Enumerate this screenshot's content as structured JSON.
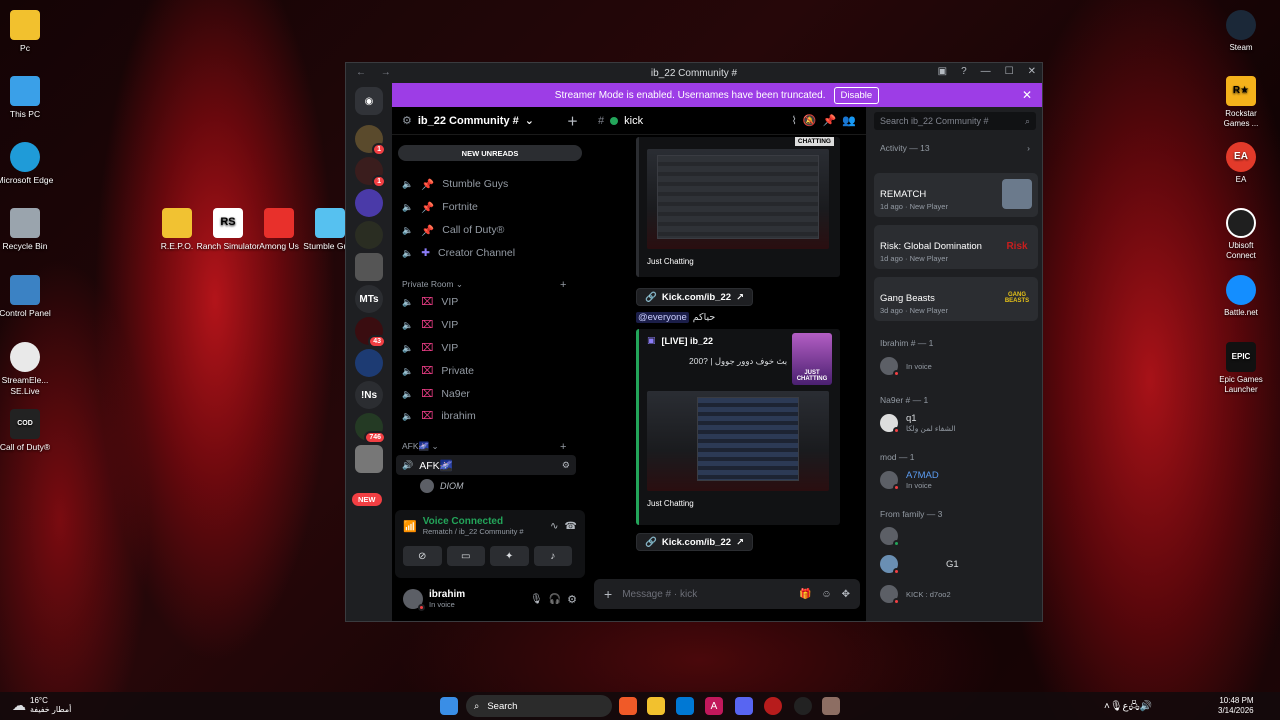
{
  "desktop_left": [
    {
      "label": "Pc",
      "icon": "folder-icon",
      "color": "#f2c12e"
    },
    {
      "label": "This PC",
      "icon": "monitor-icon",
      "color": "#3aa0e8"
    },
    {
      "label": "Microsoft Edge",
      "icon": "edge-icon",
      "color": "#1f9bd8"
    },
    {
      "label": "Recycle Bin",
      "icon": "recycle-bin-icon",
      "color": "#9aa4ad"
    },
    {
      "label": "Control Panel",
      "icon": "control-panel-icon",
      "color": "#3b82c4"
    },
    {
      "label": "StreamEle... SE.Live",
      "icon": "streamelements-icon",
      "color": "#e9e9e9"
    },
    {
      "label": "Call of Duty®",
      "icon": "call-of-duty-icon",
      "color": "#222"
    }
  ],
  "desktop_games": [
    {
      "label": "R.E.P.O.",
      "color": "#f1c232"
    },
    {
      "label": "Ranch Simulator",
      "color": "#ffffff"
    },
    {
      "label": "Among Us",
      "color": "#e8302b"
    },
    {
      "label": "Stumble Guys",
      "color": "#56c1f0"
    }
  ],
  "desktop_right": [
    {
      "label": "Steam",
      "color": "#1b2838"
    },
    {
      "label": "Rockstar Games ...",
      "color": "#f5b21b"
    },
    {
      "label": "EA",
      "color": "#e23a2a"
    },
    {
      "label": "Ubisoft Connect",
      "color": "#1f1f1f"
    },
    {
      "label": "Battle.net",
      "color": "#148eff"
    },
    {
      "label": "Epic Games Launcher",
      "color": "#111"
    }
  ],
  "window": {
    "title": "ib_22 Community #",
    "nav": "← →"
  },
  "banner": {
    "text": "Streamer Mode is enabled. Usernames have been truncated.",
    "button": "Disable"
  },
  "rail_badges": [
    "1",
    "1",
    "43",
    "746",
    "NEW"
  ],
  "rail_labels": [
    "MTs",
    "!Ns"
  ],
  "server": {
    "name": "ib_22 Community #",
    "new_unreads": "NEW UNREADS"
  },
  "channels_top": [
    "Stumble Guys",
    "Fortnite",
    "Call of Duty®",
    "Creator Channel"
  ],
  "private_category": "Private Room",
  "private_channels": [
    "VIP",
    "VIP",
    "VIP",
    "Private",
    "Na9er",
    "ibrahim"
  ],
  "afk_category": "AFK🌌",
  "afk_channel": "AFK🌌",
  "afk_user": "DIOM",
  "voice": {
    "status": "Voice Connected",
    "detail": "Rematch / ib_22 Community #"
  },
  "user": {
    "name": "ibrahim",
    "status": "In voice"
  },
  "chat": {
    "channel": "kick",
    "placeholder": "Message # · kick",
    "embed1_caption": "Just Chatting",
    "link": "Kick.com/ib_22",
    "mention": "@everyone",
    "mention_text": "حياكم",
    "embed2_title": "[LIVE] ib_22",
    "embed2_desc": "200? | بث خوف دوور جوول",
    "embed2_caption": "Just Chatting",
    "thumb_label": "JUST CHATTING",
    "chatting_tag": "CHATTING"
  },
  "members": {
    "search": "Search ib_22 Community #",
    "activity": "Activity — 13",
    "activities": [
      {
        "title": "REMATCH",
        "sub": "1d ago",
        "tag": "New Player",
        "art": "#6b7a8c"
      },
      {
        "title": "Risk: Global Domination",
        "sub": "1d ago",
        "tag": "New Player",
        "art": "#c81e1e",
        "art_text": "Risk"
      },
      {
        "title": "Gang Beasts",
        "sub": "3d ago",
        "tag": "New Player",
        "art": "#e7c318",
        "art_text": "GANG BEASTS"
      }
    ],
    "sections": [
      {
        "header": "Ibrahim # — 1",
        "members": [
          {
            "name": "",
            "sub": "In voice"
          }
        ]
      },
      {
        "header": "Na9er # — 1",
        "members": [
          {
            "name": "q1",
            "sub": "الشفاء لمن ولكا"
          }
        ]
      },
      {
        "header": "mod — 1",
        "members": [
          {
            "name": "A7MAD",
            "sub": "In voice"
          }
        ]
      },
      {
        "header": "From family — 3",
        "members": [
          {
            "name": "",
            "sub": ""
          },
          {
            "name": "G1",
            "sub": ""
          },
          {
            "name": "",
            "sub": "KICK : d7oo2"
          }
        ]
      }
    ]
  },
  "taskbar": {
    "weather_temp": "16°C",
    "weather_desc": "أمطار خفيفة",
    "search": "Search",
    "time": "10:48 PM",
    "date": "3/14/2026"
  }
}
